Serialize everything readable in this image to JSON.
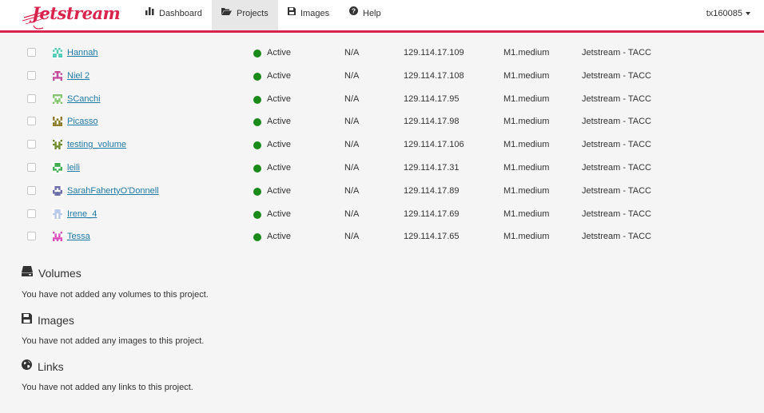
{
  "brand": {
    "name": "Jetstream",
    "color": "#d9224c"
  },
  "nav": {
    "dashboard": "Dashboard",
    "projects": "Projects",
    "images": "Images",
    "help": "Help"
  },
  "user": {
    "name": "tx160085"
  },
  "instances": [
    {
      "name": "Hannah",
      "status": "Active",
      "ipv6": "N/A",
      "ip": "129.114.17.109",
      "size": "M1.medium",
      "provider": "Jetstream - TACC",
      "avatar_color": "#49c8b4"
    },
    {
      "name": "Niel 2",
      "status": "Active",
      "ipv6": "N/A",
      "ip": "129.114.17.108",
      "size": "M1.medium",
      "provider": "Jetstream - TACC",
      "avatar_color": "#c04a9c"
    },
    {
      "name": "SCanchi",
      "status": "Active",
      "ipv6": "N/A",
      "ip": "129.114.17.95",
      "size": "M1.medium",
      "provider": "Jetstream - TACC",
      "avatar_color": "#7fc46a"
    },
    {
      "name": "Picasso",
      "status": "Active",
      "ipv6": "N/A",
      "ip": "129.114.17.98",
      "size": "M1.medium",
      "provider": "Jetstream - TACC",
      "avatar_color": "#8a7a2a"
    },
    {
      "name": "testing_volume",
      "status": "Active",
      "ipv6": "N/A",
      "ip": "129.114.17.106",
      "size": "M1.medium",
      "provider": "Jetstream - TACC",
      "avatar_color": "#6a8a2a"
    },
    {
      "name": "leili",
      "status": "Active",
      "ipv6": "N/A",
      "ip": "129.114.17.31",
      "size": "M1.medium",
      "provider": "Jetstream - TACC",
      "avatar_color": "#3aaa4a"
    },
    {
      "name": "SarahFahertyO'Donnell",
      "status": "Active",
      "ipv6": "N/A",
      "ip": "129.114.17.89",
      "size": "M1.medium",
      "provider": "Jetstream - TACC",
      "avatar_color": "#6a6aa8"
    },
    {
      "name": "Irene_4",
      "status": "Active",
      "ipv6": "N/A",
      "ip": "129.114.17.69",
      "size": "M1.medium",
      "provider": "Jetstream - TACC",
      "avatar_color": "#b8c8e8"
    },
    {
      "name": "Tessa",
      "status": "Active",
      "ipv6": "N/A",
      "ip": "129.114.17.65",
      "size": "M1.medium",
      "provider": "Jetstream - TACC",
      "avatar_color": "#d84ab8"
    }
  ],
  "status_color": "#1a8a1a",
  "sections": {
    "volumes": {
      "title": "Volumes",
      "message": "You have not added any volumes to this project.",
      "icon": "hdd-icon"
    },
    "images": {
      "title": "Images",
      "message": "You have not added any images to this project.",
      "icon": "floppy-icon"
    },
    "links": {
      "title": "Links",
      "message": "You have not added any links to this project.",
      "icon": "globe-icon"
    }
  }
}
